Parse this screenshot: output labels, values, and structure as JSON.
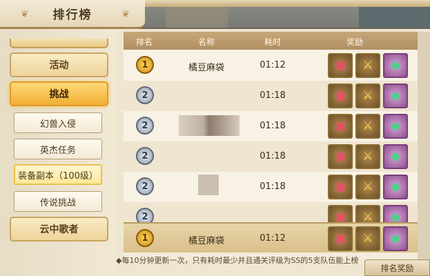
{
  "header": {
    "title": "排行榜"
  },
  "sidebar": {
    "main_items": [
      {
        "label": "活动"
      },
      {
        "label": "挑战"
      },
      {
        "label": "云中歌者"
      }
    ],
    "sub_items": [
      {
        "label": "幻兽入侵"
      },
      {
        "label": "英杰任务"
      },
      {
        "label": "装备副本（100级）"
      },
      {
        "label": "传说挑战"
      }
    ]
  },
  "table": {
    "columns": [
      "排名",
      "名称",
      "耗时",
      "奖励"
    ],
    "rows": [
      {
        "rank": "1",
        "name": "橘豆麻袋",
        "time": "01:12"
      },
      {
        "rank": "2",
        "name": "",
        "time": "01:18"
      },
      {
        "rank": "2",
        "name": "",
        "time": "01:18"
      },
      {
        "rank": "2",
        "name": "",
        "time": "01:18"
      },
      {
        "rank": "2",
        "name": "",
        "time": "01:18"
      },
      {
        "rank": "2",
        "name": "",
        "time": ""
      }
    ],
    "my_row": {
      "rank": "1",
      "name": "橘豆麻袋",
      "time": "01:12"
    },
    "reward_icons": [
      "chest-icon",
      "sword-icon",
      "gem-icon"
    ]
  },
  "footer": {
    "note": "◆每10分钟更新一次，只有耗时最少并且通关评级为SS的5支队伍能上榜",
    "rank_reward_button": "排名奖励"
  },
  "colors": {
    "accent": "#f1ae34",
    "header_bar": "#b08f62",
    "panel": "#efe6d2"
  }
}
